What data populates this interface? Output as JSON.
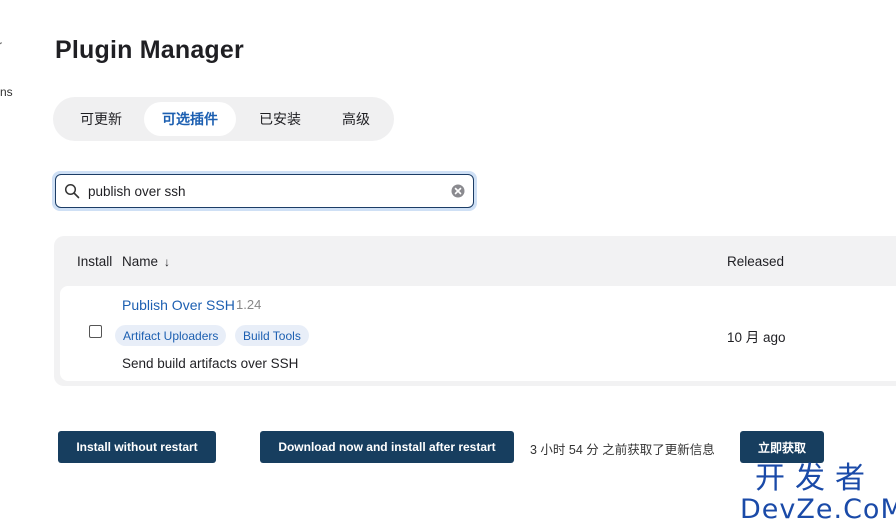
{
  "sidebar": {
    "fragment_1": "r",
    "fragment_2": "ns"
  },
  "page": {
    "title": "Plugin Manager"
  },
  "tabs": [
    {
      "label": "可更新",
      "active": false
    },
    {
      "label": "可选插件",
      "active": true
    },
    {
      "label": "已安装",
      "active": false
    },
    {
      "label": "高级",
      "active": false
    }
  ],
  "search": {
    "value": "publish over ssh",
    "placeholder": ""
  },
  "table": {
    "headers": {
      "install": "Install",
      "name": "Name",
      "name_sort": "↓",
      "released": "Released"
    },
    "rows": [
      {
        "name": "Publish Over SSH",
        "version": "1.24",
        "tags": [
          "Artifact Uploaders",
          "Build Tools"
        ],
        "description": "Send build artifacts over SSH",
        "released": "10 月 ago",
        "checked": false
      }
    ]
  },
  "actions": {
    "install_without_restart": "Install without restart",
    "download_install_after_restart": "Download now and install after restart",
    "status": "3 小时 54 分 之前获取了更新信息",
    "check_now": "立即获取"
  },
  "watermark": {
    "cn": "开发者",
    "en": "DevZe.CoM"
  },
  "colors": {
    "accent": "#1c5fb1",
    "button": "#173e5f",
    "tag_bg": "#e8eef8",
    "watermark": "#1a4aa8"
  }
}
